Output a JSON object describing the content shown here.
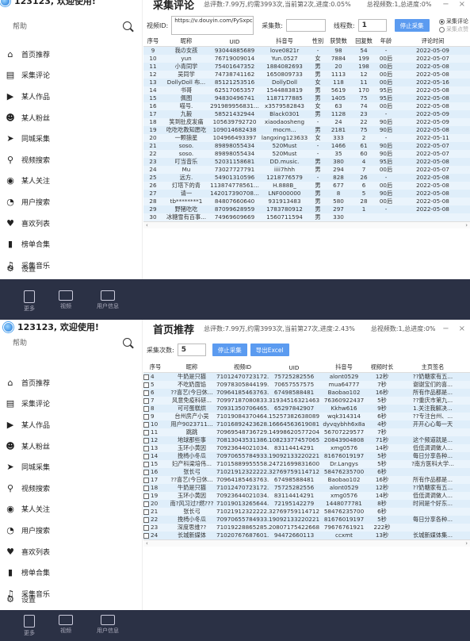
{
  "panel1": {
    "app_title": "123123, 欢迎使用!",
    "search_placeholder": "帮助",
    "nav": [
      "首页推荐",
      "采集评论",
      "某人作品",
      "某人粉丝",
      "同城采集",
      "视频搜索",
      "某人关注",
      "用户搜索",
      "喜欢列表",
      "榜单合集",
      "采集音乐"
    ],
    "settings": "设置",
    "header_title": "采集评论",
    "header_stat1": "总评数:7.99万,约需3993次,当前第2次,进度:0.05%",
    "header_stat2": "总视频数:1,总进度:0%",
    "video_id_label": "视频ID:",
    "url_value": "https://v.douyin.com/FySxpcX/",
    "collect_count_label": "采集数:",
    "collect_count_value": "",
    "threads_label": "线程数:",
    "threads_value": "1",
    "stop_button": "停止采集",
    "radio1": "采集评论",
    "radio2": "采集点赞",
    "columns": [
      "序号",
      "昵称",
      "UID",
      "抖音号",
      "性别",
      "获赞数",
      "回复数",
      "年龄",
      "评论时间"
    ],
    "rows": [
      [
        "9",
        "我の女孩",
        "93044885689",
        "love0821r",
        "-",
        "98",
        "54",
        "-",
        "2022-05-09"
      ],
      [
        "10",
        "yun",
        "76719009014",
        "Yun.0527",
        "女",
        "7884",
        "199",
        "00后",
        "2022-05-07"
      ],
      [
        "11",
        "小青同学",
        "75401647352",
        "1884082693",
        "男",
        "20",
        "198",
        "00后",
        "2022-05-08"
      ],
      [
        "12",
        "吴同学",
        "74738741162",
        "1650809733",
        "男",
        "1113",
        "12",
        "00后",
        "2022-05-08"
      ],
      [
        "13",
        "DollyDoll 布...",
        "85121253516",
        "DollyDoll",
        "女",
        "118",
        "11",
        "00后",
        "2022-05-16"
      ],
      [
        "14",
        "书哥",
        "62517065357",
        "1544883819",
        "男",
        "5619",
        "170",
        "95后",
        "2022-05-08"
      ],
      [
        "15",
        "佩图",
        "94830496741",
        "1187177885",
        "男",
        "1405",
        "75",
        "95后",
        "2022-05-08"
      ],
      [
        "16",
        "喵号.",
        "291989956831...",
        "x3579582843",
        "女",
        "63",
        "74",
        "00后",
        "2022-05-08"
      ],
      [
        "17",
        "九毅",
        "58521432944",
        "Black0301",
        "男",
        "1128",
        "23",
        "-",
        "2022-05-09"
      ],
      [
        "18",
        "笑到肚皮发痛",
        "105639792720",
        "xiaodaosheng",
        "-",
        "24",
        "22",
        "90后",
        "2022-05-09"
      ],
      [
        "19",
        "吃吃吃教知愿吃",
        "109014682438",
        "mocm...",
        "男",
        "2181",
        "75",
        "90后",
        "2022-05-08"
      ],
      [
        "20",
        "一颗狼星",
        "104966493397",
        "langxing123633",
        "女",
        "333",
        "2",
        "-",
        "2022-05-11"
      ],
      [
        "21",
        "soso.",
        "89898055434",
        "520Must",
        "-",
        "1466",
        "61",
        "90后",
        "2022-05-07"
      ],
      [
        "22",
        "soso.",
        "89898055434",
        "520Must",
        "-",
        "35",
        "60",
        "90后",
        "2022-05-07"
      ],
      [
        "23",
        "叮当音乐",
        "52031158681",
        "DD.music.",
        "男",
        "380",
        "4",
        "95后",
        "2022-05-08"
      ],
      [
        "24",
        "Mu",
        "73027727791",
        "iiii7hhh",
        "男",
        "294",
        "7",
        "00后",
        "2022-05-07"
      ],
      [
        "25",
        "远方.",
        "54901310596",
        "1218776579",
        "-",
        "828",
        "26",
        "-",
        "2022-05-08"
      ],
      [
        "26",
        "灯塔下的青",
        "113874778561...",
        "H.888B_",
        "男",
        "677",
        "6",
        "00后",
        "2022-05-08"
      ],
      [
        "27",
        "请一",
        "142017390708...",
        "LNF000000",
        "男",
        "8",
        "5",
        "90后",
        "2022-05-08"
      ],
      [
        "28",
        "tb********1",
        "84807660640",
        "931913483",
        "男",
        "580",
        "28",
        "00后",
        "2022-05-08"
      ],
      [
        "29",
        "野猪吃吃",
        "87099628959",
        "1783780912",
        "男",
        "297",
        "1",
        "-",
        "2022-05-08"
      ],
      [
        "30",
        "冰糖雪有百事...",
        "74969609669",
        "1560711594",
        "男",
        "330",
        "",
        "",
        ""
      ]
    ]
  },
  "panel2": {
    "app_title": "123123, 欢迎使用!",
    "search_placeholder": "帮助",
    "nav": [
      "首页推荐",
      "采集评论",
      "某人作品",
      "某人粉丝",
      "同城采集",
      "视频搜索",
      "某人关注",
      "用户搜索",
      "喜欢列表",
      "榜单合集",
      "采集音乐"
    ],
    "settings": "设置",
    "header_title": "首页推荐",
    "header_stat1": "总评数:7.99万,约需3993次,当前第27次,进度:2.43%",
    "header_stat2": "总视频数:1,总进度:0%",
    "collect_count_label": "采集次数:",
    "collect_count_value": "5",
    "stop_button": "停止采集",
    "export_button": "导出Excel",
    "columns": [
      "序号",
      "昵称",
      "视频ID",
      "UID",
      "抖音号",
      "视频时长",
      "主页签名"
    ],
    "rows": [
      [
        "4",
        "牛奶是只猫",
        "71012470723172...",
        "75725282556",
        "alont0529",
        "12秒",
        "??奶糖家有五..."
      ],
      [
        "5",
        "不吃奶面馅",
        "70978305844199...",
        "70657557575",
        "mua64777",
        "7秒",
        "谢谢宝们的喜..."
      ],
      [
        "6",
        "??喜艺(今日休...",
        "70964185463763...",
        "67498588481",
        "Baobao102",
        "16秒",
        "所有作品都是..."
      ],
      [
        "7",
        "风意免疫科研...",
        "70997187080833...",
        "31934516321463...",
        "76360922437",
        "5秒",
        "??重庆市第九..."
      ],
      [
        "8",
        "可可蛋糕烘",
        "70931350706465...",
        "65297842907",
        "Kkhw616",
        "9秒",
        "1.关注我解决..."
      ],
      [
        "9",
        "台州房产小吴",
        "71019084370464...",
        "15257382638089...",
        "wqk314314",
        "6秒",
        "??专注台州、..."
      ],
      [
        "10",
        "用户9023711...",
        "71016892423628...",
        "16664563619081...",
        "dyvqybhh6x8a",
        "4秒",
        "开开心心每一天"
      ],
      [
        "11",
        "跳跳",
        "70969548736729...",
        "14998620577204...",
        "56707229577",
        "7秒",
        ""
      ],
      [
        "12",
        "地球那些事",
        "70813043531386...",
        "10823377457065...",
        "20843904808",
        "71秒",
        "这个频道就是..."
      ],
      [
        "13",
        "玉环小黄因",
        "70923644021034...",
        "83114414291",
        "xmg0576",
        "14秒",
        "低低调调做人..."
      ],
      [
        "14",
        "挽椅小冬瓜",
        "70970655784933...",
        "19092133220221...",
        "81676019197",
        "5秒",
        "每日分享各种..."
      ],
      [
        "15",
        "妇产科梁培伟...",
        "71015889955558...",
        "24721699831600...",
        "Dr.Langys",
        "5秒",
        "?南方医科大学..."
      ],
      [
        "16",
        "张长弓",
        "71021912322222...",
        "32769759114712...",
        "58476235700",
        "6秒",
        ""
      ],
      [
        "17",
        "??喜艺(今日休...",
        "70964185463763...",
        "67498588481",
        "Baobao102",
        "16秒",
        "所有作品都是..."
      ],
      [
        "18",
        "牛奶是只猫",
        "71012470723172...",
        "75725282556",
        "alont0529",
        "12秒",
        "??奶糖家有五..."
      ],
      [
        "19",
        "玉环小黄因",
        "70923644021034...",
        "83114414291",
        "xmg0576",
        "14秒",
        "低低调调做人..."
      ],
      [
        "20",
        "南?风习过?燃???",
        "71019013265644...",
        "72195142279",
        "1448077781",
        "8秒",
        "时间是个好东..."
      ],
      [
        "21",
        "张长弓",
        "71021912322222...",
        "32769759114712...",
        "58476235700",
        "6秒",
        ""
      ],
      [
        "22",
        "挽椅小冬瓜",
        "70970655784933...",
        "19092133220221...",
        "81676019197",
        "5秒",
        "每日分享各种..."
      ],
      [
        "23",
        "深度思维??",
        "71019228865285...",
        "20807175422668...",
        "79676761921",
        "222秒",
        ""
      ],
      [
        "24",
        "长城新媒体",
        "71020767687601...",
        "94472660113",
        "ccxmt",
        "13秒",
        "长城新媒体集..."
      ]
    ]
  },
  "footer": {
    "items": [
      "更多",
      "视频",
      "用户信息"
    ]
  },
  "colors": {
    "accent": "#5b9bf0",
    "footer_bg": "#2b3145",
    "row_alt": "#dfeefa"
  }
}
